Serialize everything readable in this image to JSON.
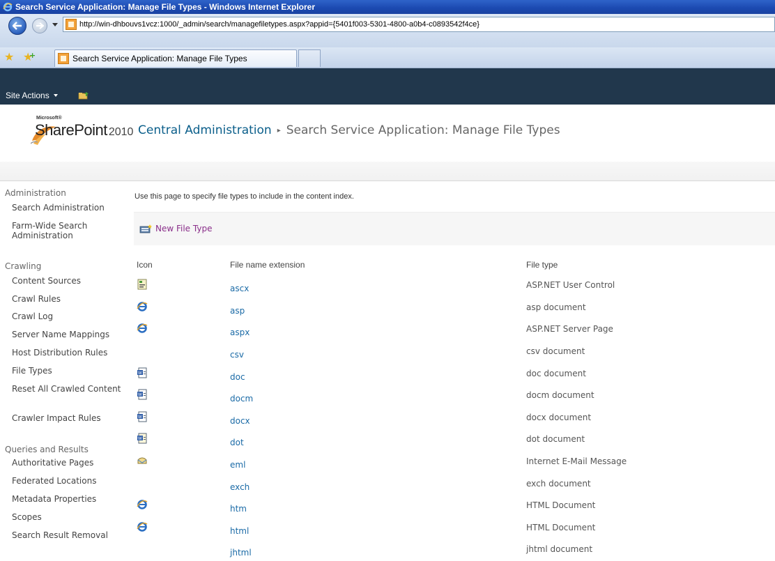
{
  "window": {
    "title": "Search Service Application: Manage File Types - Windows Internet Explorer"
  },
  "browser": {
    "url": "http://win-dhbouvs1vcz:1000/_admin/search/managefiletypes.aspx?appid={5401f003-5301-4800-a0b4-c0893542f4ce}",
    "tab_title": "Search Service Application: Manage File Types"
  },
  "ribbon": {
    "site_actions": "Site Actions"
  },
  "header": {
    "logo_brand": "Microsoft®",
    "logo_product": "SharePoint",
    "logo_version": "2010",
    "breadcrumb_root": "Central Administration",
    "breadcrumb_separator": "▸",
    "breadcrumb_page": "Search Service Application: Manage File Types"
  },
  "leftnav": {
    "sections": [
      {
        "heading": "Administration",
        "items": [
          "Search Administration",
          "Farm-Wide Search Administration"
        ]
      },
      {
        "heading": "Crawling",
        "items": [
          "Content Sources",
          "Crawl Rules",
          "Crawl Log",
          "Server Name Mappings",
          "Host Distribution Rules",
          "File Types",
          "Reset All Crawled Content",
          "Crawler Impact Rules"
        ]
      },
      {
        "heading": "Queries and Results",
        "items": [
          "Authoritative Pages",
          "Federated Locations",
          "Metadata Properties",
          "Scopes",
          "Search Result Removal"
        ]
      }
    ]
  },
  "main": {
    "intro": "Use this page to specify file types to include in the content index.",
    "new_button": "New File Type",
    "columns": {
      "icon": "Icon",
      "extension": "File name extension",
      "type": "File type"
    },
    "rows": [
      {
        "icon": "control-icon",
        "ext": "ascx",
        "type": "ASP.NET User Control"
      },
      {
        "icon": "ie-icon",
        "ext": "asp",
        "type": "asp document"
      },
      {
        "icon": "ie-icon",
        "ext": "aspx",
        "type": "ASP.NET Server Page"
      },
      {
        "icon": "",
        "ext": "csv",
        "type": "csv document"
      },
      {
        "icon": "word-doc-icon",
        "ext": "doc",
        "type": "doc document"
      },
      {
        "icon": "word-docm-icon",
        "ext": "docm",
        "type": "docm document"
      },
      {
        "icon": "word-docx-icon",
        "ext": "docx",
        "type": "docx document"
      },
      {
        "icon": "word-dot-icon",
        "ext": "dot",
        "type": "dot document"
      },
      {
        "icon": "email-icon",
        "ext": "eml",
        "type": "Internet E-Mail Message"
      },
      {
        "icon": "",
        "ext": "exch",
        "type": "exch document"
      },
      {
        "icon": "ie-icon",
        "ext": "htm",
        "type": "HTML Document"
      },
      {
        "icon": "ie-icon",
        "ext": "html",
        "type": "HTML Document"
      },
      {
        "icon": "",
        "ext": "jhtml",
        "type": "jhtml document"
      }
    ]
  },
  "colors": {
    "ribbon": "#21374c",
    "link": "#1a6aa6",
    "new_button": "#8a2f8a",
    "breadcrumb_root": "#0a5e8a"
  }
}
